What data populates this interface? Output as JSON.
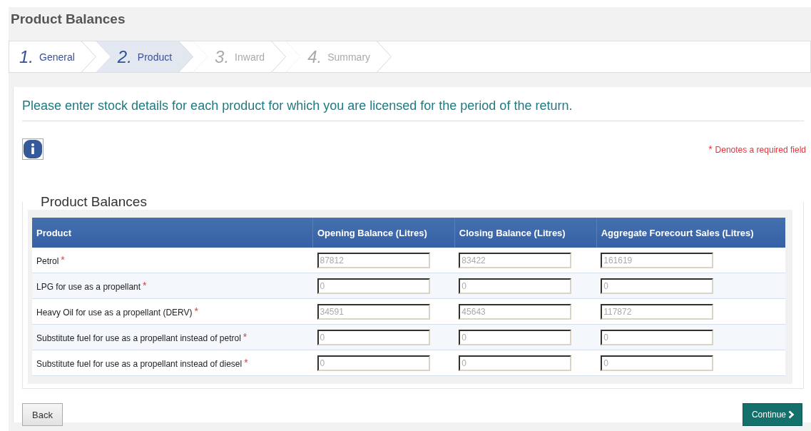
{
  "page_title": "Product Balances",
  "steps": [
    {
      "number": "1.",
      "label": "General",
      "selected": false,
      "disabled": false
    },
    {
      "number": "2.",
      "label": "Product",
      "selected": true,
      "disabled": false
    },
    {
      "number": "3.",
      "label": "Inward",
      "selected": false,
      "disabled": true
    },
    {
      "number": "4.",
      "label": "Summary",
      "selected": false,
      "disabled": true
    }
  ],
  "intro": "Please enter stock details for each product for which you are licensed for the period of the return.",
  "required_note": {
    "mark": "*",
    "text": "Denotes a required field"
  },
  "section_title": "Product Balances",
  "table": {
    "columns": [
      "Product",
      "Opening Balance (Litres)",
      "Closing Balance (Litres)",
      "Aggregate Forecourt Sales (Litres)"
    ],
    "rows": [
      {
        "product": "Petrol",
        "required": true,
        "values": [
          "87812",
          "83422",
          "161619"
        ]
      },
      {
        "product": "LPG for use as a propellant",
        "required": true,
        "values": [
          "0",
          "0",
          "0"
        ]
      },
      {
        "product": "Heavy Oil for use as a propellant (DERV)",
        "required": true,
        "values": [
          "34591",
          "45643",
          "117872"
        ]
      },
      {
        "product": "Substitute fuel for use as a propellant instead of petrol",
        "required": true,
        "values": [
          "0",
          "0",
          "0"
        ]
      },
      {
        "product": "Substitute fuel for use as a propellant instead of diesel",
        "required": true,
        "values": [
          "0",
          "0",
          "0"
        ]
      }
    ]
  },
  "buttons": {
    "back": "Back",
    "continue": "Continue"
  }
}
